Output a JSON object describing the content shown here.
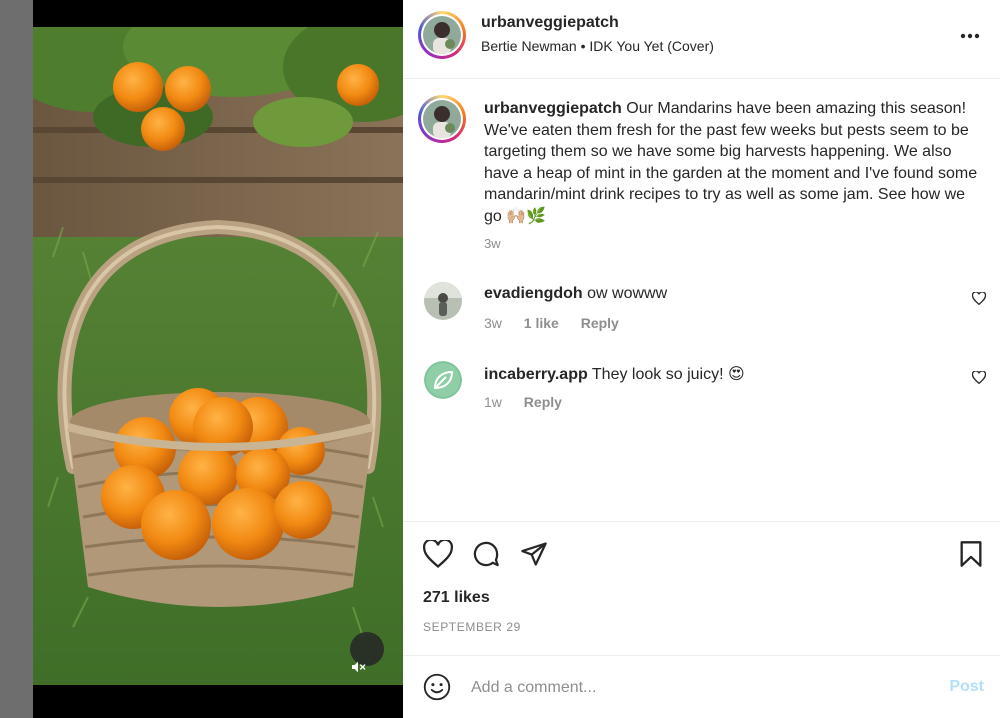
{
  "post": {
    "username": "urbanveggiepatch",
    "audio": "Bertie Newman • IDK You Yet (Cover)",
    "more_icon": "more-horizontal-icon",
    "caption": "Our Mandarins have been amazing this season! We've eaten them fresh for the past few weeks but pests seem to be targeting them so we have some big harvests happening. We also have a heap of mint in the garden at the moment and I've found some mandarin/mint drink recipes to try as well as some jam. See how we go 🙌🏼🌿",
    "caption_time": "3w",
    "likes": "271 likes",
    "date": "SEPTEMBER 29"
  },
  "comments": [
    {
      "username": "evadiengdoh",
      "text": "ow wowww",
      "time": "3w",
      "likes": "1 like",
      "reply": "Reply"
    },
    {
      "username": "incaberry.app",
      "text": "They look so juicy! 😍",
      "time": "1w",
      "reply": "Reply"
    }
  ],
  "add_comment": {
    "placeholder": "Add a comment...",
    "post_label": "Post"
  },
  "colors": {
    "post_button": "#b2dffc",
    "secondary_text": "#8e8e8e",
    "incaberry_avatar": "#7ec49a"
  }
}
